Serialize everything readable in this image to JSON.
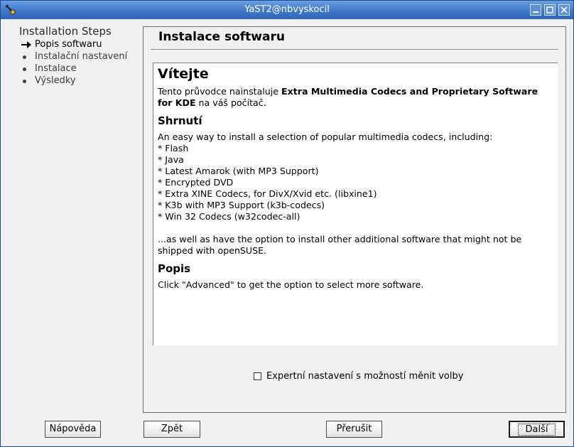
{
  "window": {
    "title": "YaST2@nbvyskocil"
  },
  "sidebar": {
    "title": "Installation Steps",
    "steps": [
      {
        "label": "Popis softwaru"
      },
      {
        "label": "Instalační nastavení"
      },
      {
        "label": "Instalace"
      },
      {
        "label": "Výsledky"
      }
    ]
  },
  "main": {
    "title": "Instalace softwaru",
    "content": {
      "heading": "Vítejte",
      "intro_prefix": "Tento průvodce nainstaluje ",
      "intro_bold": "Extra Multimedia Codecs and Proprietary Software for KDE",
      "intro_suffix": " na váš počítač.",
      "summary_heading": "Shrnutí",
      "summary_lead": "An easy way to install a selection of popular multimedia codecs, including:",
      "items": [
        "* Flash",
        "* Java",
        "* Latest Amarok (with MP3 Support)",
        "* Encrypted DVD",
        "* Extra XINE Codecs, for DivX/Xvid etc. (libxine1)",
        "* K3b with MP3 Support (k3b-codecs)",
        "* Win 32 Codecs (w32codec-all)"
      ],
      "extra": "...as well as have the option to install other additional software that might not be shipped with openSUSE.",
      "description_heading": "Popis",
      "description": "Click \"Advanced\" to get the option to select more software."
    },
    "expert_checkbox": {
      "label": "Expertní nastavení s možností měnit volby",
      "checked": false
    }
  },
  "buttons": {
    "help": "Nápověda",
    "back": "Zpět",
    "abort": "Přerušit",
    "next": "Další"
  }
}
